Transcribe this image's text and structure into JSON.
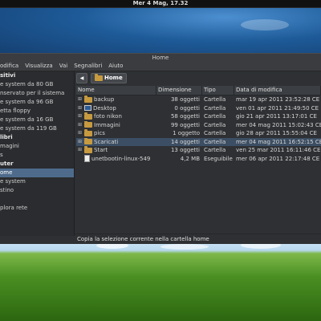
{
  "panel": {
    "clock": "Mer  4 Mag, 17.32"
  },
  "window": {
    "title": "Home",
    "menu": [
      "odifica",
      "Visualizza",
      "Vai",
      "Segnalibri",
      "Aiuto"
    ]
  },
  "sidebar": {
    "items": [
      {
        "label": "sitivi",
        "type": "head"
      },
      {
        "label": "e system da 80 GB",
        "type": "item"
      },
      {
        "label": "nservato per il sistema",
        "type": "item"
      },
      {
        "label": "e system da 96 GB",
        "type": "item"
      },
      {
        "label": "etta floppy",
        "type": "item"
      },
      {
        "label": "e system da 16 GB",
        "type": "item"
      },
      {
        "label": "e system da 119 GB",
        "type": "item"
      },
      {
        "label": "libri",
        "type": "head"
      },
      {
        "label": "magini",
        "type": "item"
      },
      {
        "label": "s",
        "type": "item"
      },
      {
        "label": "uter",
        "type": "head"
      },
      {
        "label": "ome",
        "type": "item",
        "selected": true
      },
      {
        "label": "e system",
        "type": "item"
      },
      {
        "label": "stino",
        "type": "item"
      },
      {
        "label": "",
        "type": "item"
      },
      {
        "label": "plora rete",
        "type": "item"
      }
    ]
  },
  "pathbar": {
    "back": "◀",
    "location": "Home"
  },
  "table": {
    "headers": [
      "Nome",
      "Dimensione",
      "Tipo",
      "Data di modifica"
    ],
    "rows": [
      {
        "name": "backup",
        "size": "38 oggetti",
        "type": "Cartella",
        "date": "mar 19 apr 2011 23:52:28 CE",
        "icon": "folder-icon",
        "expandable": true
      },
      {
        "name": "Desktop",
        "size": "0 oggetti",
        "type": "Cartella",
        "date": "ven 01 apr 2011 21:49:50 CE",
        "icon": "desktop-icon",
        "expandable": true
      },
      {
        "name": "foto nikon",
        "size": "58 oggetti",
        "type": "Cartella",
        "date": "gio 21 apr 2011 13:17:01 CE",
        "icon": "folder-icon",
        "expandable": true
      },
      {
        "name": "Immagini",
        "size": "99 oggetti",
        "type": "Cartella",
        "date": "mer 04 mag 2011 15:02:43 CE",
        "icon": "folder-icon",
        "expandable": true
      },
      {
        "name": "pics",
        "size": "1 oggetto",
        "type": "Cartella",
        "date": "gio 28 apr 2011 15:55:04 CE",
        "icon": "folder-icon",
        "expandable": true
      },
      {
        "name": "Scaricati",
        "size": "14 oggetti",
        "type": "Cartella",
        "date": "mer 04 mag 2011 16:52:15 CE",
        "icon": "folder-icon",
        "expandable": true,
        "selected": true
      },
      {
        "name": "Start",
        "size": "13 oggetti",
        "type": "Cartella",
        "date": "ven 25 mar 2011 16:11:46 CE",
        "icon": "folder-icon",
        "expandable": true
      },
      {
        "name": "unetbootin-linux-549",
        "size": "4,2 MB",
        "type": "Eseguibile",
        "date": "mer 06 apr 2011 22:17:48 CE",
        "icon": "file-icon",
        "expandable": false
      }
    ]
  },
  "status": "Copia la selezione corrente nella cartella home"
}
